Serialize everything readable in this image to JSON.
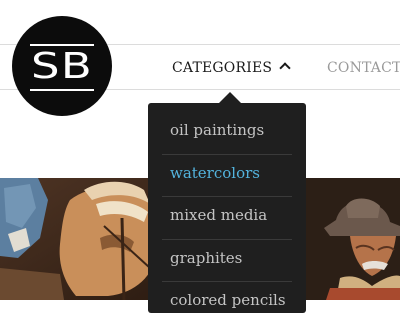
{
  "logo": {
    "monogram": "SB"
  },
  "nav": {
    "categories_label": "CATEGORIES",
    "contact_label": "CONTACT"
  },
  "dropdown": {
    "items": [
      {
        "label": "oil paintings",
        "active": false
      },
      {
        "label": "watercolors",
        "active": true
      },
      {
        "label": "mixed media",
        "active": false
      },
      {
        "label": "graphites",
        "active": false
      },
      {
        "label": "colored pencils",
        "active": false
      }
    ]
  },
  "colors": {
    "logo_background": "#0c0c0c",
    "dropdown_background": "#1f1f1f",
    "active_item": "#53b3dd",
    "menu_text": "#c4c4c4",
    "nav_inactive": "#9a9a9a"
  },
  "icons": {
    "nav_toggle": "chevron-up-icon"
  }
}
